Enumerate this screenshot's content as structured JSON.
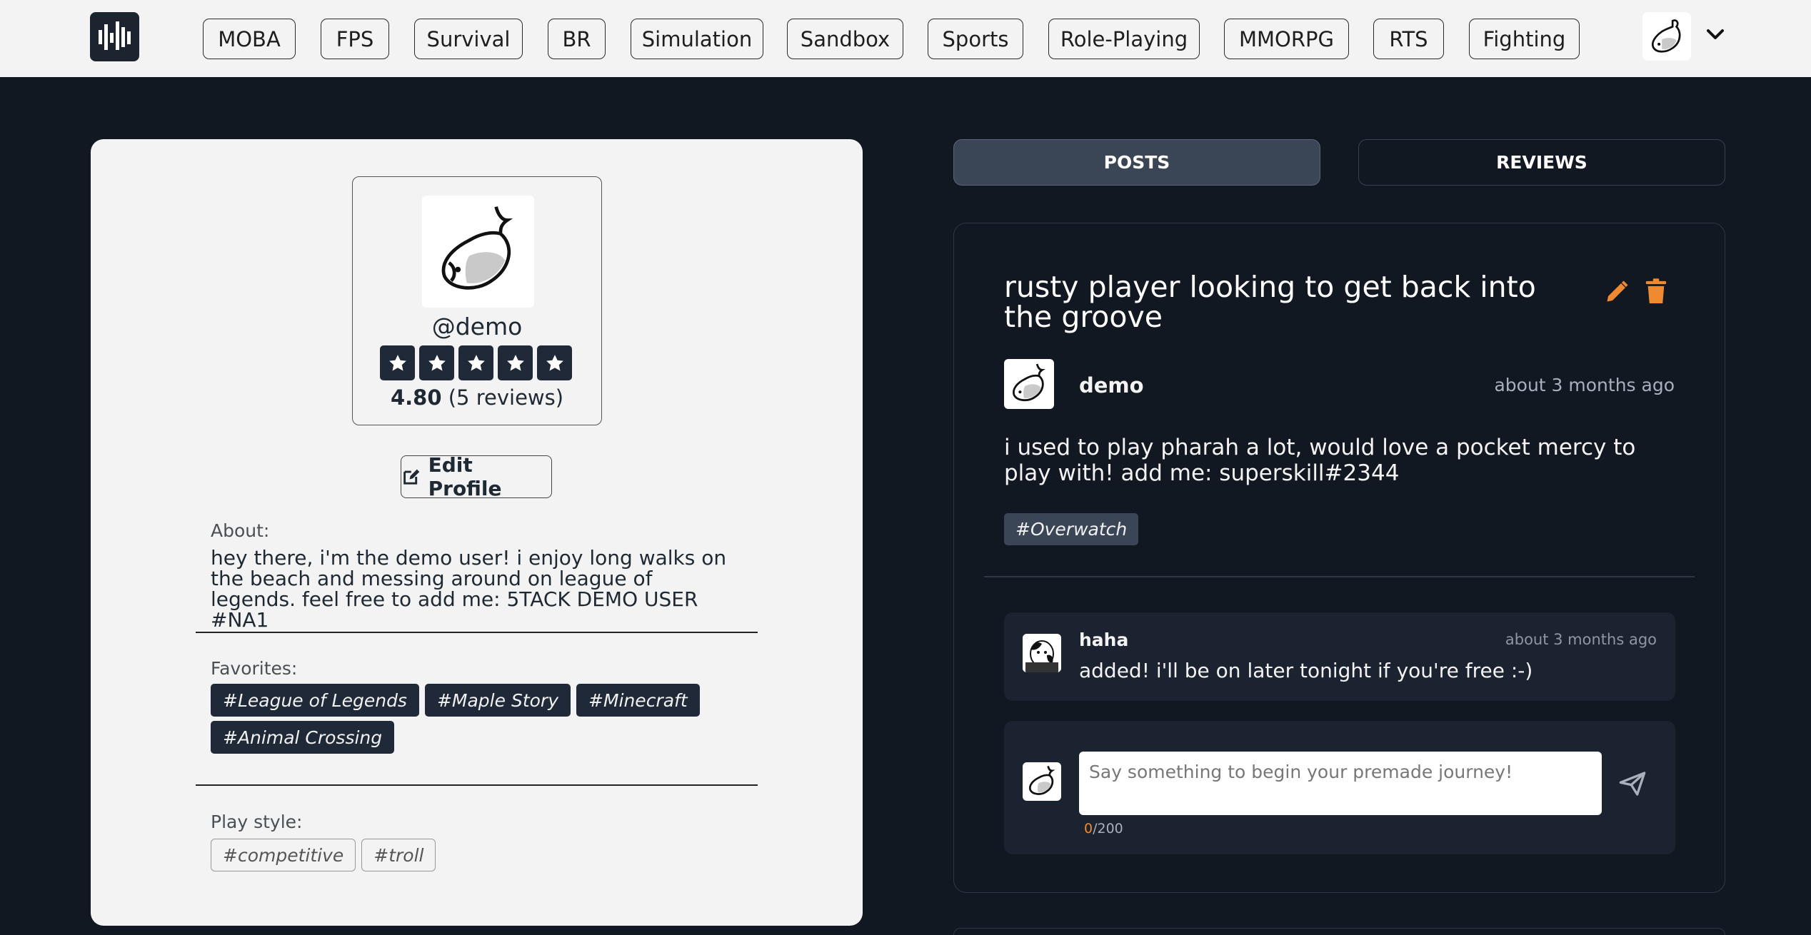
{
  "nav": {
    "categories": [
      "MOBA",
      "FPS",
      "Survival",
      "BR",
      "Simulation",
      "Sandbox",
      "Sports",
      "Role-Playing",
      "MMORPG",
      "RTS",
      "Fighting"
    ]
  },
  "profile": {
    "handle": "@demo",
    "rating_value": "4.80",
    "rating_count": "(5 reviews)",
    "stars": 5,
    "edit_label": "Edit Profile",
    "about_label": "About:",
    "about_text": "hey there, i'm the demo user! i enjoy long walks on the beach and messing around on league of legends. feel free to add me: 5TACK DEMO USER #NA1",
    "favorites_label": "Favorites:",
    "favorites": [
      "#League of Legends",
      "#Maple Story",
      "#Minecraft",
      "#Animal Crossing"
    ],
    "playstyle_label": "Play style:",
    "playstyles": [
      "#competitive",
      "#troll"
    ]
  },
  "tabs": {
    "posts": "POSTS",
    "reviews": "REVIEWS"
  },
  "post": {
    "title": "rusty player looking to get back into the groove",
    "author": "demo",
    "time": "about 3 months ago",
    "body": "i used to play pharah a lot, would love a pocket mercy to play with! add me: superskill#2344",
    "game_tag": "#Overwatch",
    "comment": {
      "author": "haha",
      "time": "about 3 months ago",
      "text": "added! i'll be on later tonight if you're free :-)"
    },
    "composer": {
      "placeholder": "Say something to begin your premade journey!",
      "count_current": "0",
      "count_max": "/200"
    }
  },
  "colors": {
    "background": "#111821",
    "accent_orange": "#f08a30",
    "card_light": "#f3f3f3",
    "tag_dark": "#1f2937"
  },
  "icons": {
    "logo": "equalizer-logo",
    "edit": "pencil-icon",
    "delete": "trash-icon",
    "send": "paper-plane-icon",
    "menu": "chevron-down-icon"
  }
}
